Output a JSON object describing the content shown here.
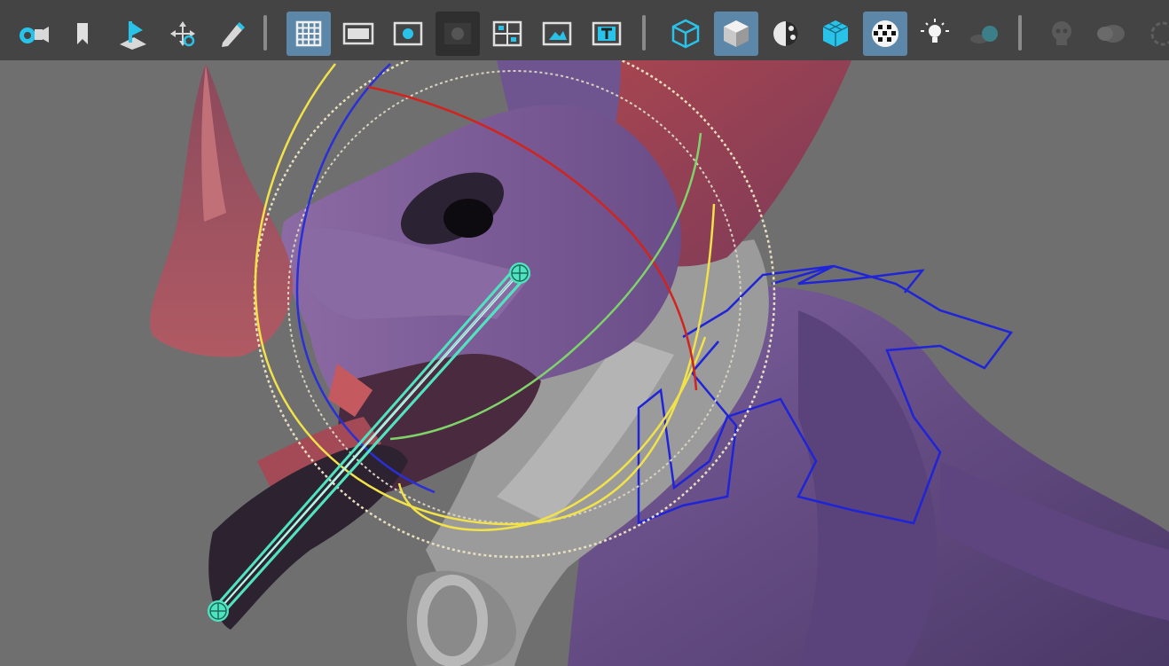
{
  "toolbar": {
    "icons": [
      "camera-attributes-icon",
      "bookmark-icon",
      "image-plane-icon",
      "move-pivot-icon",
      "grease-pencil-icon",
      "grid-icon",
      "film-gate-icon",
      "resolution-gate-icon",
      "gate-mask-icon",
      "field-chart-icon",
      "safe-action-icon",
      "safe-title-icon",
      "wireframe-icon",
      "smooth-shade-icon",
      "default-material-icon",
      "shaded-wireframe-icon",
      "textured-icon",
      "lighting-icon",
      "shadows-icon",
      "ambient-occlusion-icon",
      "motion-blur-icon",
      "anti-aliasing-icon"
    ],
    "active": [
      "grid-icon",
      "smooth-shade-icon",
      "textured-icon"
    ],
    "pressed": [
      "gate-mask-icon"
    ]
  },
  "colors": {
    "toolbar_bg": "#444444",
    "active_bg": "#5d87a8",
    "icon_cyan": "#29c3ea",
    "viewport_bg": "#6f6f6f",
    "body_purple": "#6a4f8e",
    "horn_red": "#a9464f",
    "harness_gray": "#a8a8a8",
    "gizmo_yellow": "#f2e24a",
    "gizmo_blue": "#2a2fd6",
    "gizmo_red": "#d1241f",
    "gizmo_green": "#7fd36a",
    "joint_cyan": "#4fe4c0",
    "ik_curve_blue": "#1f24d8"
  }
}
